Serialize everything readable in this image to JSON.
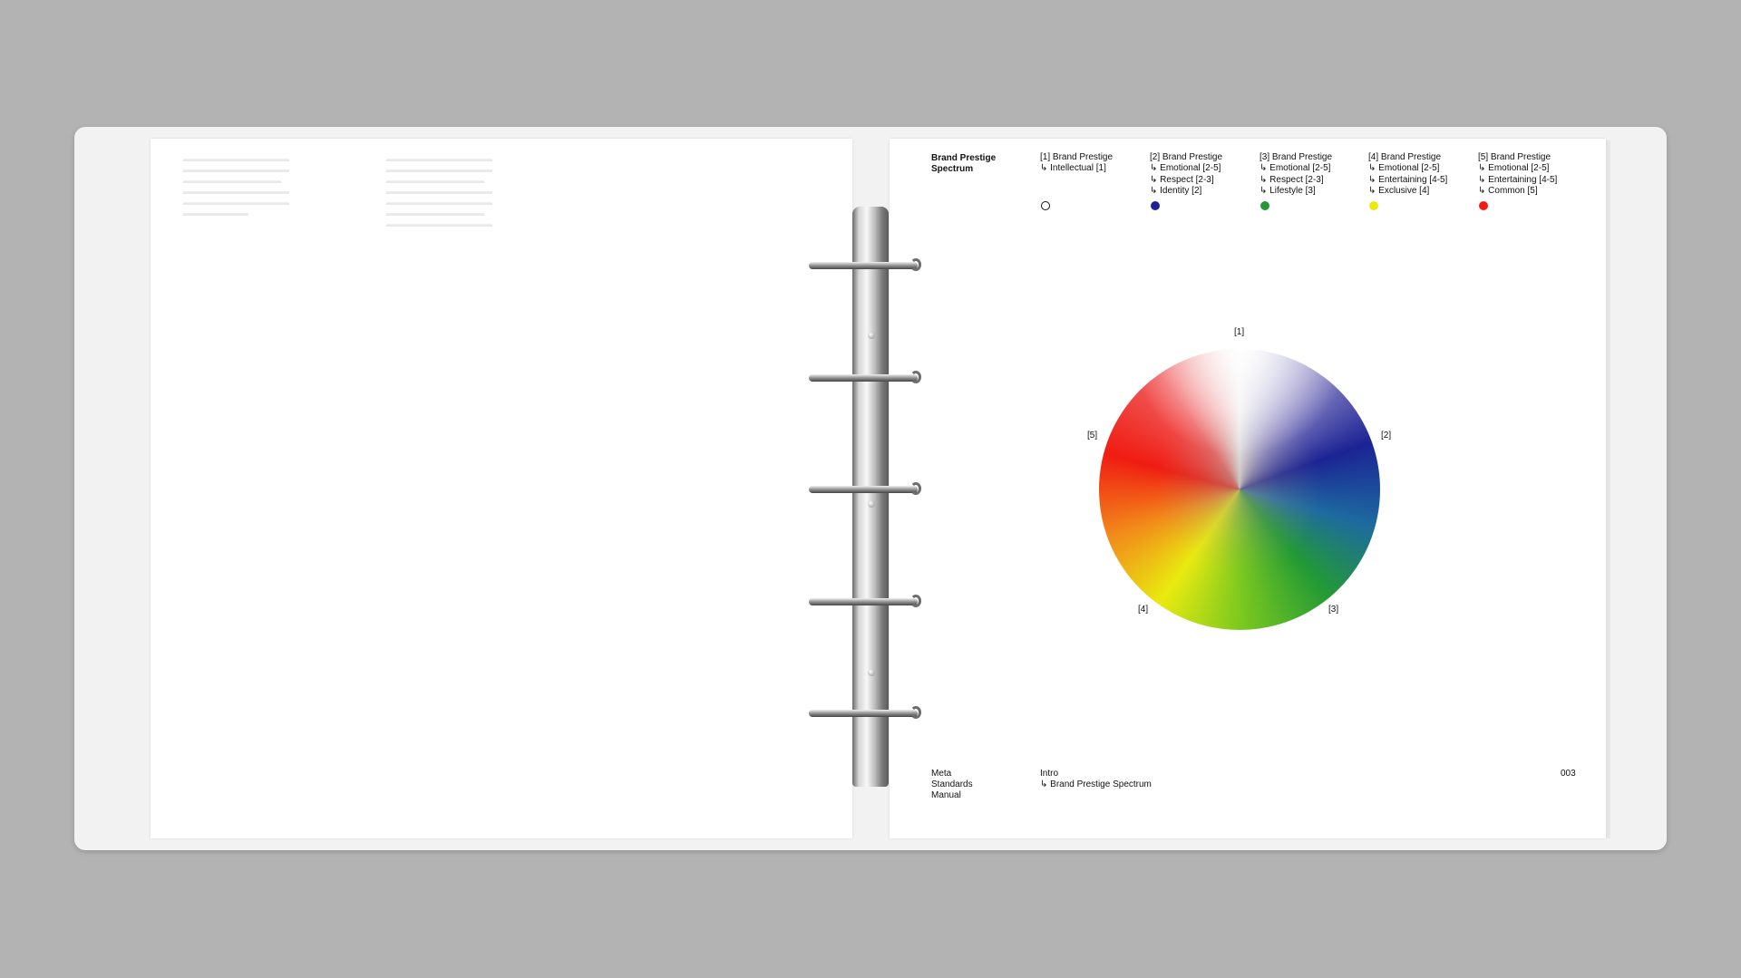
{
  "spread": {
    "title": "Brand Prestige Spectrum",
    "legend": [
      {
        "heading": "[1] Brand Prestige",
        "lines": [
          "↳ Intellectual [1]"
        ],
        "color": "#ffffff"
      },
      {
        "heading": "[2] Brand Prestige",
        "lines": [
          "↳ Emotional [2-5]",
          "↳ Respect [2-3]",
          "↳ Identity [2]"
        ],
        "color": "#1c2394"
      },
      {
        "heading": "[3] Brand Prestige",
        "lines": [
          "↳ Emotional [2-5]",
          "↳ Respect [2-3]",
          "↳ Lifestyle [3]"
        ],
        "color": "#239a35"
      },
      {
        "heading": "[4] Brand Prestige",
        "lines": [
          "↳ Emotional [2-5]",
          "↳ Entertaining [4-5]",
          "↳ Exclusive [4]"
        ],
        "color": "#e9ea10"
      },
      {
        "heading": "[5] Brand Prestige",
        "lines": [
          "↳ Emotional [2-5]",
          "↳ Entertaining [4-5]",
          "↳ Common [5]"
        ],
        "color": "#f01c12"
      }
    ],
    "wheel_labels": {
      "l1": "[1]",
      "l2": "[2]",
      "l3": "[3]",
      "l4": "[4]",
      "l5": "[5]"
    },
    "footer": {
      "doc_title": "Meta\nStandards\nManual",
      "section": "Intro",
      "subsection": "↳ Brand Prestige Spectrum",
      "page_number": "003"
    }
  }
}
